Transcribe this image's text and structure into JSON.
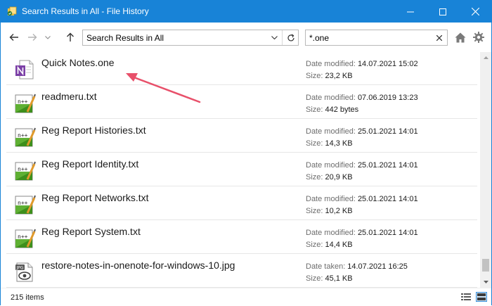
{
  "window": {
    "title": "Search Results in All - File History",
    "accent": "#1883d7",
    "controls": [
      "minimize-icon",
      "maximize-icon",
      "close-icon"
    ]
  },
  "nav": {
    "address": "Search Results in All",
    "search_value": "*.one"
  },
  "files": [
    {
      "name": "Quick Notes.one",
      "icon": "onenote-file-icon",
      "k1": "Date modified:",
      "v1": "14.07.2021 15:02",
      "k2": "Size:",
      "v2": "23,2 KB"
    },
    {
      "name": "readmeru.txt",
      "icon": "notepadpp-file-icon",
      "k1": "Date modified:",
      "v1": "07.06.2019 13:23",
      "k2": "Size:",
      "v2": "442 bytes"
    },
    {
      "name": "Reg Report Histories.txt",
      "icon": "notepadpp-file-icon",
      "k1": "Date modified:",
      "v1": "25.01.2021 14:01",
      "k2": "Size:",
      "v2": "14,3 KB"
    },
    {
      "name": "Reg Report Identity.txt",
      "icon": "notepadpp-file-icon",
      "k1": "Date modified:",
      "v1": "25.01.2021 14:01",
      "k2": "Size:",
      "v2": "20,9 KB"
    },
    {
      "name": "Reg Report Networks.txt",
      "icon": "notepadpp-file-icon",
      "k1": "Date modified:",
      "v1": "25.01.2021 14:01",
      "k2": "Size:",
      "v2": "10,2 KB"
    },
    {
      "name": "Reg Report System.txt",
      "icon": "notepadpp-file-icon",
      "k1": "Date modified:",
      "v1": "25.01.2021 14:01",
      "k2": "Size:",
      "v2": "14,4 KB"
    },
    {
      "name": "restore-notes-in-onenote-for-windows-10.jpg",
      "icon": "jpg-file-icon",
      "k1": "Date taken:",
      "v1": "14.07.2021 16:25",
      "k2": "Size:",
      "v2": "45,1 KB"
    }
  ],
  "status": {
    "item_count": "215 items"
  },
  "annotation": {
    "arrow_color": "#e8506a"
  }
}
